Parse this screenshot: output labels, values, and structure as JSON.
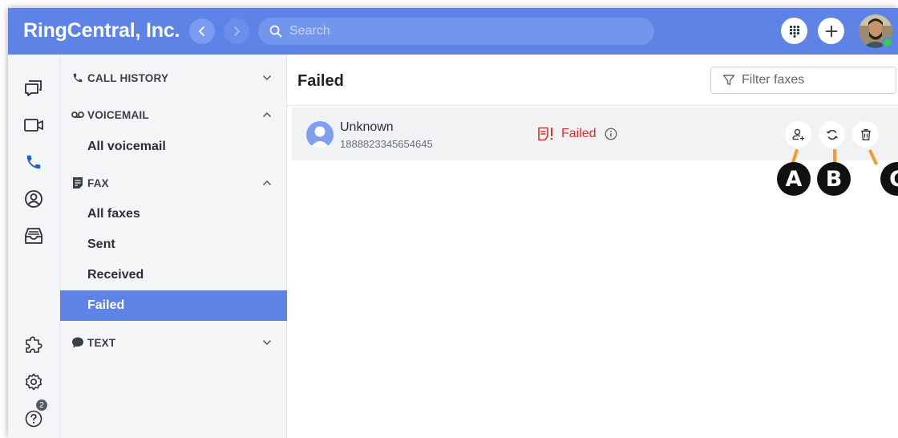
{
  "header": {
    "company": "RingCentral, Inc.",
    "search_placeholder": "Search"
  },
  "menu": {
    "sections": [
      {
        "label": "CALL HISTORY",
        "icon": "phone-icon",
        "expanded": false
      },
      {
        "label": "VOICEMAIL",
        "icon": "voicemail-icon",
        "expanded": true
      },
      {
        "label": "FAX",
        "icon": "fax-icon",
        "expanded": true
      },
      {
        "label": "TEXT",
        "icon": "chat-bubble-icon",
        "expanded": false
      }
    ],
    "voicemail_items": [
      "All voicemail"
    ],
    "fax_items": [
      "All faxes",
      "Sent",
      "Received",
      "Failed"
    ],
    "active_item": "Failed"
  },
  "rail": {
    "icons": [
      "messages-icon",
      "video-icon",
      "phone-icon",
      "contacts-icon",
      "inbox-icon",
      "apps-icon",
      "settings-icon",
      "help-icon"
    ],
    "help_badge": "2"
  },
  "main": {
    "title": "Failed",
    "filter_placeholder": "Filter faxes",
    "row": {
      "name": "Unknown",
      "number": "1888823345654645",
      "status": "Failed"
    },
    "callouts": [
      "A",
      "B",
      "C"
    ]
  },
  "colors": {
    "brand": "#5d83e6",
    "failed": "#d6302b",
    "callout_line": "#f39b2b"
  }
}
